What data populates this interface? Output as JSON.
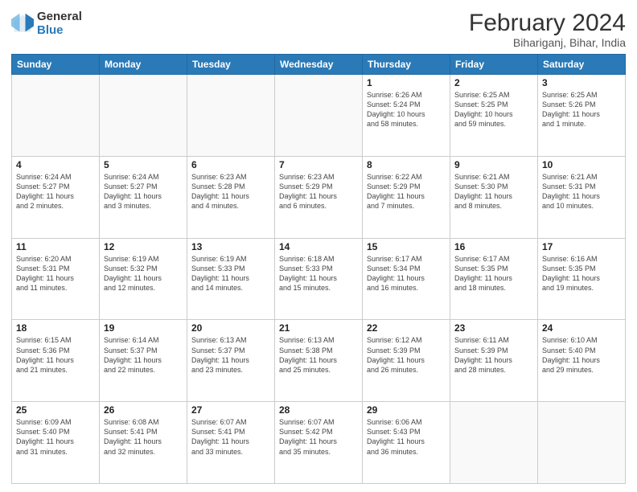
{
  "logo": {
    "line1": "General",
    "line2": "Blue"
  },
  "title": "February 2024",
  "subtitle": "Bihariganj, Bihar, India",
  "days_of_week": [
    "Sunday",
    "Monday",
    "Tuesday",
    "Wednesday",
    "Thursday",
    "Friday",
    "Saturday"
  ],
  "weeks": [
    [
      {
        "day": "",
        "info": ""
      },
      {
        "day": "",
        "info": ""
      },
      {
        "day": "",
        "info": ""
      },
      {
        "day": "",
        "info": ""
      },
      {
        "day": "1",
        "info": "Sunrise: 6:26 AM\nSunset: 5:24 PM\nDaylight: 10 hours\nand 58 minutes."
      },
      {
        "day": "2",
        "info": "Sunrise: 6:25 AM\nSunset: 5:25 PM\nDaylight: 10 hours\nand 59 minutes."
      },
      {
        "day": "3",
        "info": "Sunrise: 6:25 AM\nSunset: 5:26 PM\nDaylight: 11 hours\nand 1 minute."
      }
    ],
    [
      {
        "day": "4",
        "info": "Sunrise: 6:24 AM\nSunset: 5:27 PM\nDaylight: 11 hours\nand 2 minutes."
      },
      {
        "day": "5",
        "info": "Sunrise: 6:24 AM\nSunset: 5:27 PM\nDaylight: 11 hours\nand 3 minutes."
      },
      {
        "day": "6",
        "info": "Sunrise: 6:23 AM\nSunset: 5:28 PM\nDaylight: 11 hours\nand 4 minutes."
      },
      {
        "day": "7",
        "info": "Sunrise: 6:23 AM\nSunset: 5:29 PM\nDaylight: 11 hours\nand 6 minutes."
      },
      {
        "day": "8",
        "info": "Sunrise: 6:22 AM\nSunset: 5:29 PM\nDaylight: 11 hours\nand 7 minutes."
      },
      {
        "day": "9",
        "info": "Sunrise: 6:21 AM\nSunset: 5:30 PM\nDaylight: 11 hours\nand 8 minutes."
      },
      {
        "day": "10",
        "info": "Sunrise: 6:21 AM\nSunset: 5:31 PM\nDaylight: 11 hours\nand 10 minutes."
      }
    ],
    [
      {
        "day": "11",
        "info": "Sunrise: 6:20 AM\nSunset: 5:31 PM\nDaylight: 11 hours\nand 11 minutes."
      },
      {
        "day": "12",
        "info": "Sunrise: 6:19 AM\nSunset: 5:32 PM\nDaylight: 11 hours\nand 12 minutes."
      },
      {
        "day": "13",
        "info": "Sunrise: 6:19 AM\nSunset: 5:33 PM\nDaylight: 11 hours\nand 14 minutes."
      },
      {
        "day": "14",
        "info": "Sunrise: 6:18 AM\nSunset: 5:33 PM\nDaylight: 11 hours\nand 15 minutes."
      },
      {
        "day": "15",
        "info": "Sunrise: 6:17 AM\nSunset: 5:34 PM\nDaylight: 11 hours\nand 16 minutes."
      },
      {
        "day": "16",
        "info": "Sunrise: 6:17 AM\nSunset: 5:35 PM\nDaylight: 11 hours\nand 18 minutes."
      },
      {
        "day": "17",
        "info": "Sunrise: 6:16 AM\nSunset: 5:35 PM\nDaylight: 11 hours\nand 19 minutes."
      }
    ],
    [
      {
        "day": "18",
        "info": "Sunrise: 6:15 AM\nSunset: 5:36 PM\nDaylight: 11 hours\nand 21 minutes."
      },
      {
        "day": "19",
        "info": "Sunrise: 6:14 AM\nSunset: 5:37 PM\nDaylight: 11 hours\nand 22 minutes."
      },
      {
        "day": "20",
        "info": "Sunrise: 6:13 AM\nSunset: 5:37 PM\nDaylight: 11 hours\nand 23 minutes."
      },
      {
        "day": "21",
        "info": "Sunrise: 6:13 AM\nSunset: 5:38 PM\nDaylight: 11 hours\nand 25 minutes."
      },
      {
        "day": "22",
        "info": "Sunrise: 6:12 AM\nSunset: 5:39 PM\nDaylight: 11 hours\nand 26 minutes."
      },
      {
        "day": "23",
        "info": "Sunrise: 6:11 AM\nSunset: 5:39 PM\nDaylight: 11 hours\nand 28 minutes."
      },
      {
        "day": "24",
        "info": "Sunrise: 6:10 AM\nSunset: 5:40 PM\nDaylight: 11 hours\nand 29 minutes."
      }
    ],
    [
      {
        "day": "25",
        "info": "Sunrise: 6:09 AM\nSunset: 5:40 PM\nDaylight: 11 hours\nand 31 minutes."
      },
      {
        "day": "26",
        "info": "Sunrise: 6:08 AM\nSunset: 5:41 PM\nDaylight: 11 hours\nand 32 minutes."
      },
      {
        "day": "27",
        "info": "Sunrise: 6:07 AM\nSunset: 5:41 PM\nDaylight: 11 hours\nand 33 minutes."
      },
      {
        "day": "28",
        "info": "Sunrise: 6:07 AM\nSunset: 5:42 PM\nDaylight: 11 hours\nand 35 minutes."
      },
      {
        "day": "29",
        "info": "Sunrise: 6:06 AM\nSunset: 5:43 PM\nDaylight: 11 hours\nand 36 minutes."
      },
      {
        "day": "",
        "info": ""
      },
      {
        "day": "",
        "info": ""
      }
    ]
  ]
}
